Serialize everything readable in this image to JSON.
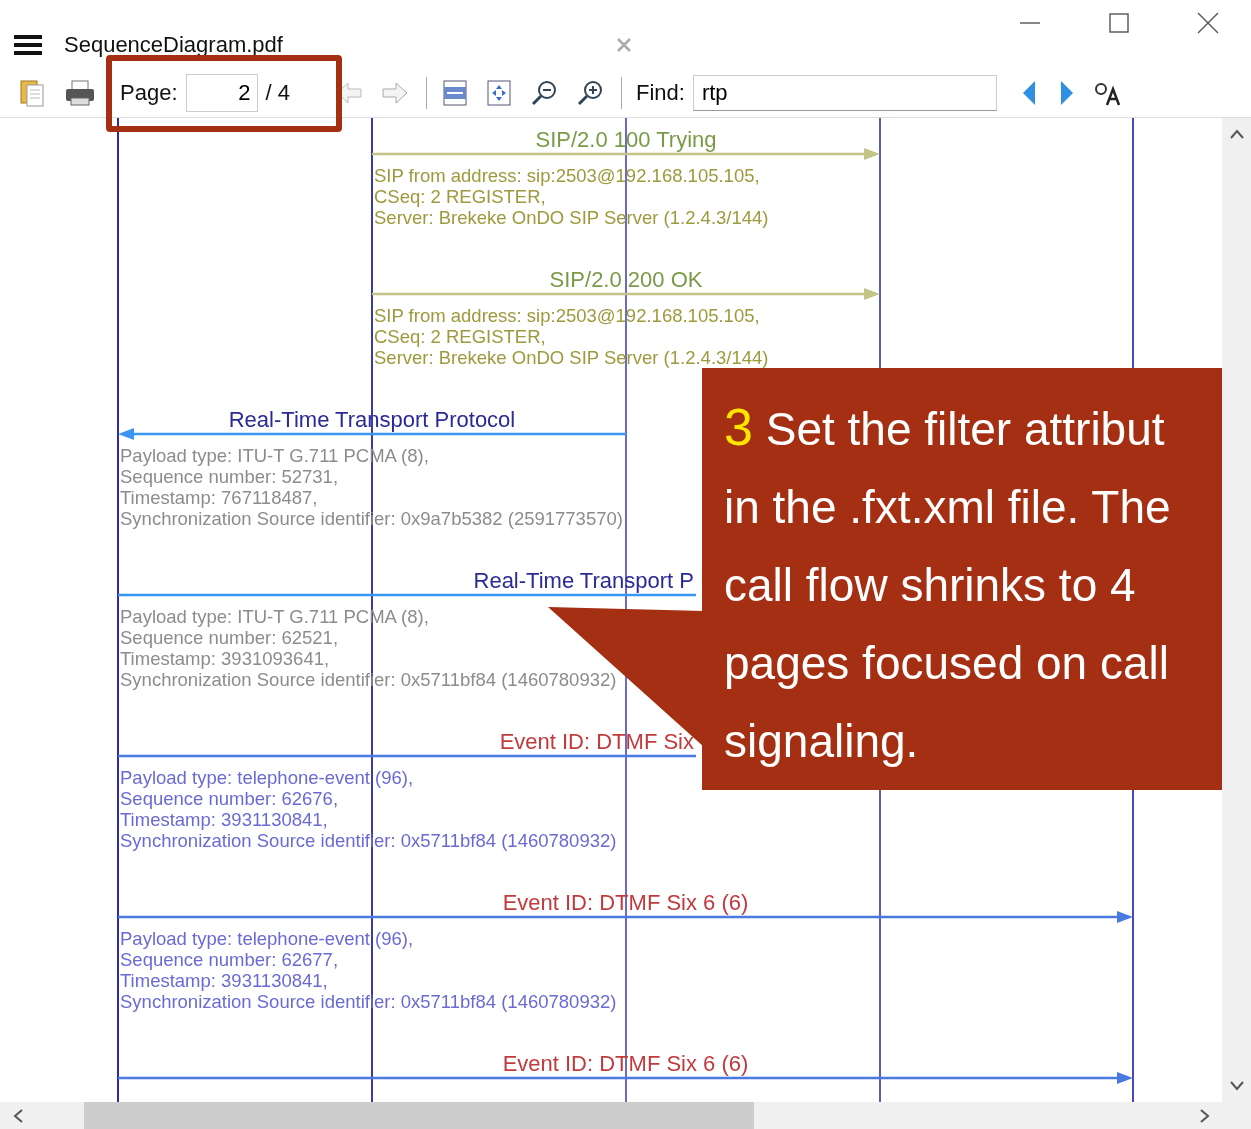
{
  "window": {
    "title": "SequenceDiagram.pdf"
  },
  "toolbar": {
    "page_label": "Page:",
    "page_value": "2",
    "page_total": "/ 4",
    "find_label": "Find:",
    "find_value": "rtp"
  },
  "messages": [
    {
      "kind": "sip",
      "leftward": false,
      "covered": false,
      "label": "SIP/2.0 100 Trying",
      "details": [
        "SIP from address: sip:2503@192.168.105.105,",
        "CSeq: 2 REGISTER,",
        "Server: Brekeke OnDO SIP Server (1.2.4.3/144)"
      ]
    },
    {
      "kind": "sip",
      "leftward": false,
      "covered": false,
      "label": "SIP/2.0 200 OK",
      "details": [
        "SIP from address: sip:2503@192.168.105.105,",
        "CSeq: 2 REGISTER,",
        "Server: Brekeke OnDO SIP Server (1.2.4.3/144)"
      ]
    },
    {
      "kind": "rtp",
      "leftward": true,
      "covered": false,
      "label": "Real-Time Transport Protocol",
      "details": [
        "Payload type: ITU-T G.711 PCMA (8),",
        "Sequence number: 52731,",
        "Timestamp: 767118487,",
        "Synchronization Source identifier: 0x9a7b5382 (2591773570)"
      ]
    },
    {
      "kind": "rtp",
      "leftward": false,
      "covered": true,
      "label": "Real-Time Transport P",
      "details": [
        "Payload type: ITU-T G.711 PCMA (8),",
        "Sequence number: 62521,",
        "Timestamp: 3931093641,",
        "Synchronization Source identifier: 0x5711bf84 (1460780932)"
      ]
    },
    {
      "kind": "dtmf",
      "leftward": false,
      "covered": true,
      "label": "Event ID: DTMF Six",
      "details": [
        "Payload type: telephone-event (96),",
        "Sequence number: 62676,",
        "Timestamp: 3931130841,",
        "Synchronization Source identifier: 0x5711bf84 (1460780932)"
      ]
    },
    {
      "kind": "dtmf",
      "leftward": false,
      "covered": false,
      "label": "Event ID: DTMF Six 6 (6)",
      "details": [
        "Payload type: telephone-event (96),",
        "Sequence number: 62677,",
        "Timestamp: 3931130841,",
        "Synchronization Source identifier: 0x5711bf84 (1460780932)"
      ]
    },
    {
      "kind": "dtmf",
      "leftward": false,
      "covered": false,
      "label": "Event ID: DTMF Six 6 (6)"
    }
  ],
  "callout": {
    "step": "3",
    "lines": [
      "Set the filter attribut",
      "in the .fxt.xml file. The",
      "call flow shrinks to 4",
      "pages focused on call",
      "signaling."
    ]
  }
}
